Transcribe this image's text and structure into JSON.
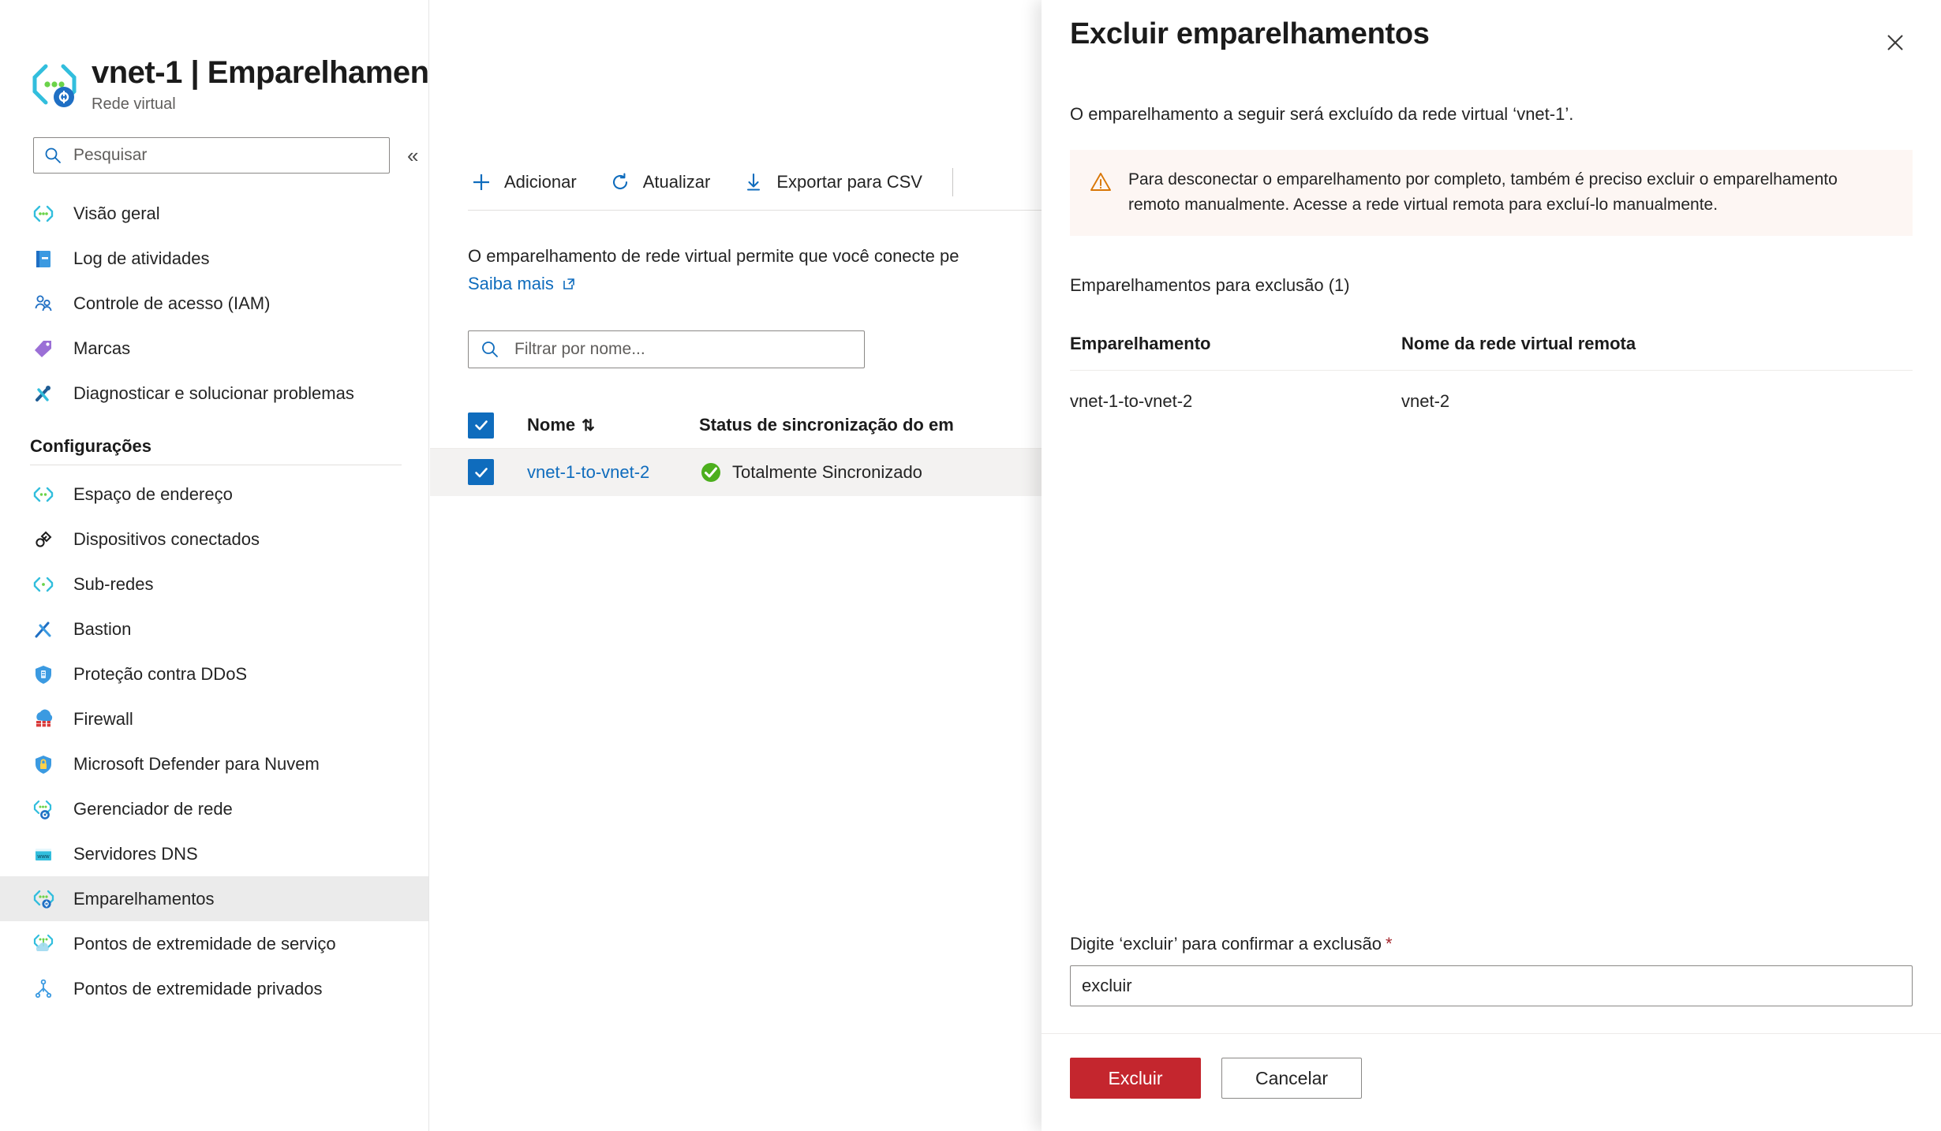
{
  "header": {
    "resource_name": "vnet-1",
    "separator": "|",
    "page_section": "Emparelhamentos",
    "subtitle": "Rede virtual",
    "favorite_icon": "star-icon",
    "more_icon": "ellipsis-icon"
  },
  "sidebar": {
    "search_placeholder": "Pesquisar",
    "collapse_icon": "chevron-double-left-icon",
    "items": [
      {
        "label": "Visão geral",
        "icon": "vnet-icon"
      },
      {
        "label": "Log de atividades",
        "icon": "activity-log-icon"
      },
      {
        "label": "Controle de acesso (IAM)",
        "icon": "access-control-icon"
      },
      {
        "label": "Marcas",
        "icon": "tag-icon"
      },
      {
        "label": "Diagnosticar e solucionar problemas",
        "icon": "troubleshoot-icon"
      }
    ],
    "settings_section": "Configurações",
    "settings_items": [
      {
        "label": "Espaço de endereço",
        "icon": "address-space-icon"
      },
      {
        "label": "Dispositivos conectados",
        "icon": "connected-devices-icon"
      },
      {
        "label": "Sub-redes",
        "icon": "subnet-icon"
      },
      {
        "label": "Bastion",
        "icon": "bastion-icon"
      },
      {
        "label": "Proteção contra DDoS",
        "icon": "ddos-shield-icon"
      },
      {
        "label": "Firewall",
        "icon": "firewall-icon"
      },
      {
        "label": "Microsoft Defender para Nuvem",
        "icon": "defender-lock-icon"
      },
      {
        "label": "Gerenciador de rede",
        "icon": "network-manager-icon"
      },
      {
        "label": "Servidores DNS",
        "icon": "dns-server-icon"
      },
      {
        "label": "Emparelhamentos",
        "icon": "peering-icon",
        "selected": true
      },
      {
        "label": "Pontos de extremidade de serviço",
        "icon": "service-endpoint-icon"
      },
      {
        "label": "Pontos de extremidade privados",
        "icon": "private-endpoint-icon"
      }
    ]
  },
  "toolbar": {
    "add_label": "Adicionar",
    "add_icon": "plus-icon",
    "refresh_label": "Atualizar",
    "refresh_icon": "refresh-icon",
    "export_label": "Exportar para CSV",
    "export_icon": "download-icon"
  },
  "main": {
    "description": "O emparelhamento de rede virtual permite que você conecte pe",
    "learn_more": "Saiba mais",
    "learn_more_icon": "external-link-icon",
    "filter_placeholder": "Filtrar por nome...",
    "table": {
      "columns": [
        "Nome",
        "Status de sincronização do em"
      ],
      "sort_icon": "sort-arrows-icon",
      "rows": [
        {
          "name": "vnet-1-to-vnet-2",
          "status": "Totalmente Sincronizado",
          "status_icon": "check-circle-icon",
          "checked": true
        }
      ],
      "header_checked": true
    }
  },
  "panel": {
    "title": "Excluir emparelhamentos",
    "close_icon": "close-icon",
    "description": "O emparelhamento a seguir será excluído da rede virtual ‘vnet-1’.",
    "warning": {
      "icon": "warning-triangle-icon",
      "text": "Para desconectar o emparelhamento por completo, também é preciso excluir o emparelhamento remoto manualmente. Acesse a rede virtual remota para excluí-lo manualmente."
    },
    "list_label": "Emparelhamentos para exclusão (1)",
    "table": {
      "columns": [
        "Emparelhamento",
        "Nome da rede virtual remota"
      ],
      "rows": [
        {
          "peering": "vnet-1-to-vnet-2",
          "remote_vnet": "vnet-2"
        }
      ]
    },
    "confirm_label": "Digite ‘excluir’ para confirmar a exclusão",
    "required_mark": "*",
    "confirm_value": "excluir",
    "delete_button": "Excluir",
    "cancel_button": "Cancelar"
  },
  "colors": {
    "azure_blue": "#0f6cbd",
    "danger_red": "#c4262e",
    "success_green": "#4caf1d",
    "warning_orange": "#d97706",
    "warning_bg": "#fdf6f3",
    "selected_row": "#f3f2f1"
  }
}
